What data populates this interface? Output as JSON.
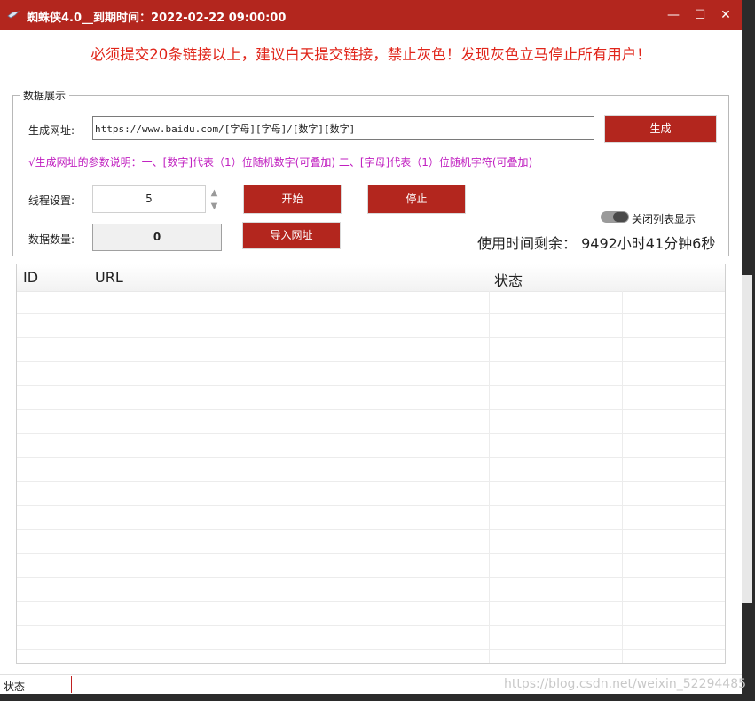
{
  "window": {
    "title": "蜘蛛侠4.0__到期时间：2022-02-22 09:00:00",
    "minimize": "—",
    "maximize": "☐",
    "close": "✕"
  },
  "notice": "必须提交20条链接以上，建议白天提交链接，禁止灰色！发现灰色立马停止所有用户！",
  "group": {
    "legend": "数据展示"
  },
  "url": {
    "label": "生成网址:",
    "value": "https://www.baidu.com/[字母][字母]/[数字][数字]",
    "generate_button": "生成",
    "hint": "√生成网址的参数说明：一、[数字]代表（1）位随机数字(可叠加) 二、[字母]代表（1）位随机字符(可叠加)"
  },
  "threads": {
    "label": "线程设置:",
    "value": "5"
  },
  "buttons": {
    "start": "开始",
    "stop": "停止",
    "import": "导入网址"
  },
  "count": {
    "label": "数据数量:",
    "value": "0"
  },
  "toggle": {
    "label": "关闭列表显示"
  },
  "timer": "使用时间剩余：  9492小时41分钟6秒",
  "table": {
    "columns": [
      "ID",
      "URL",
      "状态"
    ]
  },
  "statusbar": {
    "label": "状态"
  },
  "watermark": "https://blog.csdn.net/weixin_52294485",
  "colors": {
    "accent": "#b3261e",
    "notice": "#e0251a",
    "hint": "#c020c0"
  },
  "icons": {
    "app": "spider-app-icon",
    "spin_up": "triangle-up-icon",
    "spin_down": "triangle-down-icon"
  }
}
